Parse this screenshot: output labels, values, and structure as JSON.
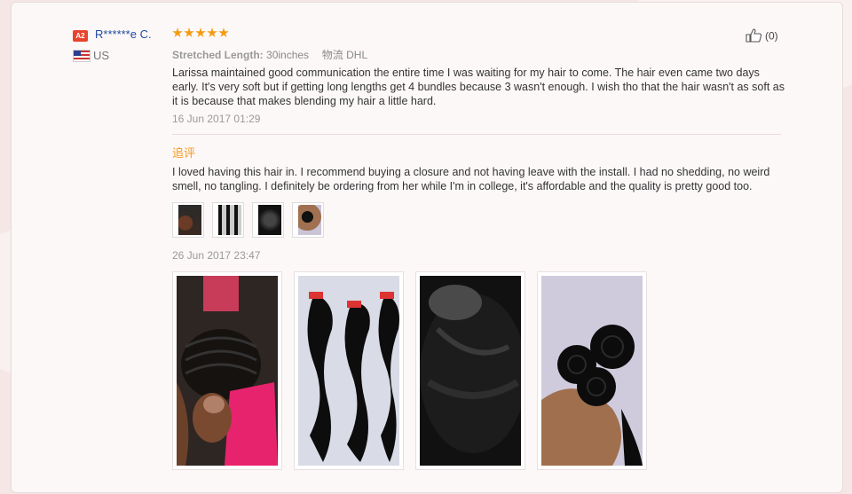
{
  "review": {
    "badge": "A2",
    "username": "R******e C.",
    "rating": 5,
    "country": "US",
    "attributes": {
      "length_label": "Stretched Length:",
      "length_value": "30inches",
      "shipping_label": "物流",
      "shipping_value": "DHL"
    },
    "helpful_count": "(0)",
    "text": "Larissa maintained good communication the entire time I was waiting for my hair to come. The hair even came two days early. It's very soft but if getting long lengths get 4 bundles because 3 wasn't enough. I wish tho that the hair wasn't as soft as it is because that makes blending my hair a little hard.",
    "date": "16 Jun 2017 01:29"
  },
  "append": {
    "label": "追评",
    "text": "I loved having this hair in. I recommend buying a closure and not having leave with the install. I had no shedding, no weird smell, no tangling. I definitely be ordering from her while I'm in college, it's affordable and the quality is pretty good too.",
    "date": "26 Jun 2017 23:47",
    "photo_count": 4
  },
  "colors": {
    "accent_orange": "#f29b1d",
    "username_blue": "#1f4aa0",
    "star_gold": "#f39c12",
    "badge_red": "#e8432d"
  },
  "icons": {
    "like": "thumb-up-icon",
    "flag": "us-flag-icon",
    "star": "star-icon"
  }
}
